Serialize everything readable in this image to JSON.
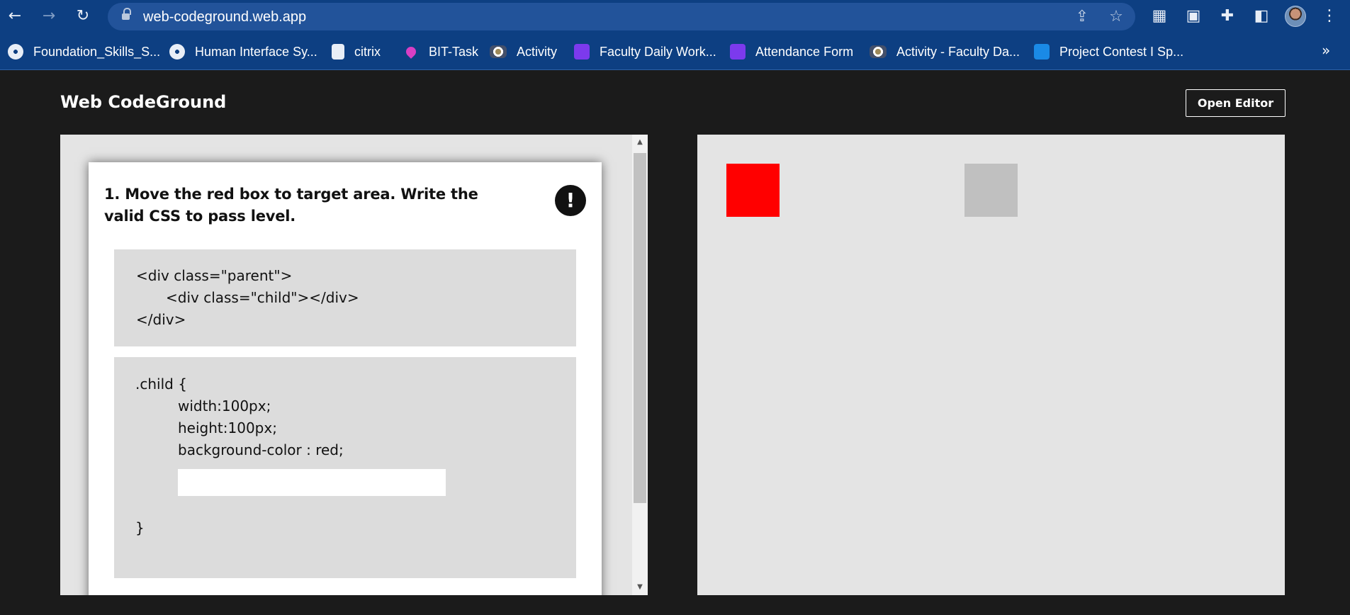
{
  "browser": {
    "url": "web-codeground.web.app",
    "bookmarks": [
      {
        "label": "Foundation_Skills_S...",
        "icon": "globe-icon"
      },
      {
        "label": "Human Interface Sy...",
        "icon": "globe-icon"
      },
      {
        "label": "citrix",
        "icon": "lock-icon"
      },
      {
        "label": "BIT-Task",
        "icon": "flame-icon"
      },
      {
        "label": "Activity",
        "icon": "college-logo-icon"
      },
      {
        "label": "Faculty Daily Work...",
        "icon": "forms-icon"
      },
      {
        "label": "Attendance Form",
        "icon": "forms-icon"
      },
      {
        "label": "Activity - Faculty Da...",
        "icon": "college-logo-icon"
      },
      {
        "label": "Project Contest I Sp...",
        "icon": "project-icon"
      }
    ],
    "more_bookmarks": "»"
  },
  "page": {
    "title": "Web CodeGround",
    "open_editor_label": "Open Editor"
  },
  "level": {
    "question": "1. Move the red box to target area. Write the valid CSS to pass level.",
    "html_lines": [
      "<div class=\"parent\">",
      "<div class=\"child\"></div>",
      "</div>"
    ],
    "css_selector": ".child {",
    "css_rules": [
      "width:100px;",
      "height:100px;",
      "background-color : red;"
    ],
    "css_input_value": "",
    "css_close": "}"
  },
  "preview": {
    "box_color": "#ff0000",
    "target_color": "#c0c0c0"
  },
  "colors": {
    "browser_chrome": "#0d3f82",
    "page_background": "#1b1b1b",
    "panel_background": "#e4e4e4",
    "code_background": "#dcdcdc"
  }
}
